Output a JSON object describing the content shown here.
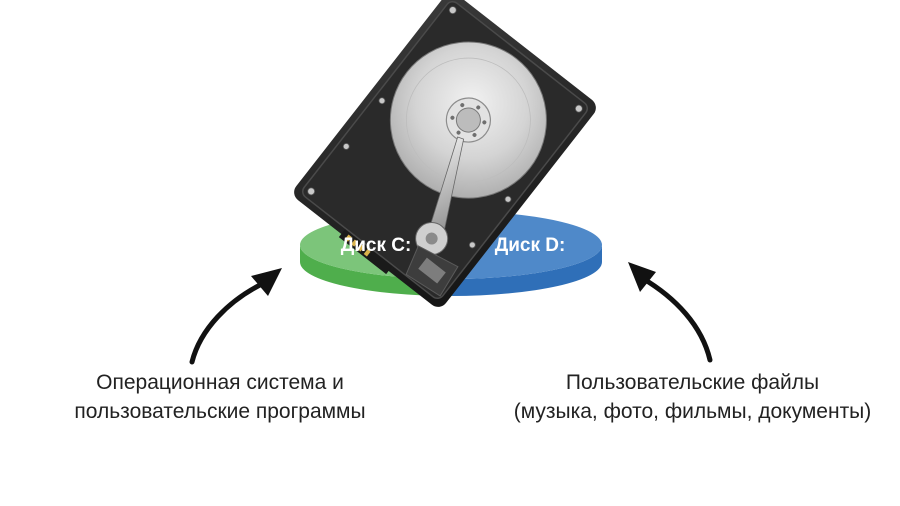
{
  "colors": {
    "green_top": "#7cc57a",
    "green_side": "#4fae4c",
    "blue_top": "#4f89c9",
    "blue_side": "#2f6fb8",
    "arrow": "#111111",
    "text": "#222222"
  },
  "disk": {
    "left_label": "Диск C:",
    "right_label": "Диск D:"
  },
  "captions": {
    "left": {
      "line1": "Операционная система и",
      "line2": "пользовательские программы"
    },
    "right": {
      "line1": "Пользовательские файлы",
      "line2": "(музыка, фото, фильмы, документы)"
    }
  },
  "icons": {
    "drive": "hard-drive-icon",
    "left_arrow": "curved-arrow-up-right-icon",
    "right_arrow": "curved-arrow-up-left-icon"
  }
}
